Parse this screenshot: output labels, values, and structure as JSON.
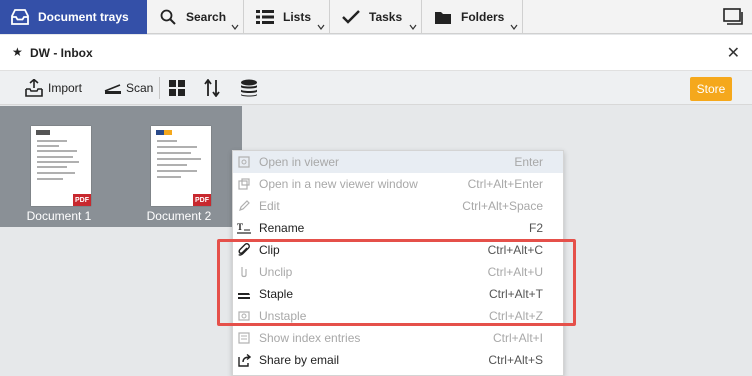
{
  "nav": {
    "tabs": [
      {
        "label": "Document trays",
        "icon": "inbox-tray-icon"
      },
      {
        "label": "Search",
        "icon": "search-icon"
      },
      {
        "label": "Lists",
        "icon": "list-icon"
      },
      {
        "label": "Tasks",
        "icon": "checkmark-icon"
      },
      {
        "label": "Folders",
        "icon": "folder-icon"
      }
    ],
    "right_icon": "window-icon"
  },
  "titlebar": {
    "title": "DW - Inbox"
  },
  "toolbar": {
    "import_label": "Import",
    "scan_label": "Scan",
    "store_label": "Store",
    "store_color": "#f5a81c"
  },
  "documents": [
    {
      "label": "Document 1",
      "badge": "PDF"
    },
    {
      "label": "Document 2",
      "badge": "PDF"
    }
  ],
  "context_menu": {
    "items": [
      {
        "label": "Open in viewer",
        "shortcut": "Enter",
        "enabled": false,
        "icon": "viewer-icon"
      },
      {
        "label": "Open in a new viewer window",
        "shortcut": "Ctrl+Alt+Enter",
        "enabled": false,
        "icon": "new-window-icon"
      },
      {
        "label": "Edit",
        "shortcut": "Ctrl+Alt+Space",
        "enabled": false,
        "icon": "pencil-icon"
      },
      {
        "label": "Rename",
        "shortcut": "F2",
        "enabled": true,
        "icon": "rename-icon"
      },
      {
        "label": "Clip",
        "shortcut": "Ctrl+Alt+C",
        "enabled": true,
        "icon": "paperclip-icon"
      },
      {
        "label": "Unclip",
        "shortcut": "Ctrl+Alt+U",
        "enabled": false,
        "icon": "unclip-icon"
      },
      {
        "label": "Staple",
        "shortcut": "Ctrl+Alt+T",
        "enabled": true,
        "icon": "stapler-icon"
      },
      {
        "label": "Unstaple",
        "shortcut": "Ctrl+Alt+Z",
        "enabled": false,
        "icon": "unstaple-icon"
      },
      {
        "label": "Show index entries",
        "shortcut": "Ctrl+Alt+I",
        "enabled": false,
        "icon": "index-icon"
      },
      {
        "label": "Share by email",
        "shortcut": "Ctrl+Alt+S",
        "enabled": true,
        "icon": "share-icon"
      }
    ]
  },
  "highlight_color": "#e5504a",
  "accent_color": "#3450a8"
}
